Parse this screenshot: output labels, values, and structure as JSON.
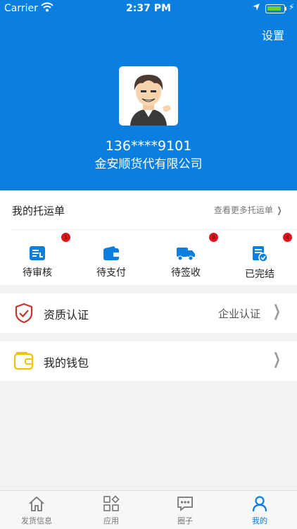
{
  "status_bar": {
    "carrier": "Carrier",
    "time": "2:37 PM"
  },
  "header": {
    "settings_label": "设置",
    "phone": "136****9101",
    "company": "金安顺货代有限公司"
  },
  "orders": {
    "title": "我的托运单",
    "more_label": "查看更多托运单",
    "statuses": [
      {
        "label": "待审核",
        "badge": "1"
      },
      {
        "label": "待支付"
      },
      {
        "label": "待签收",
        "badge": "8"
      },
      {
        "label": "已完结",
        "badge": "4"
      }
    ]
  },
  "qualification": {
    "label": "资质认证",
    "value": "企业认证"
  },
  "wallet": {
    "label": "我的钱包"
  },
  "tabbar": {
    "active": "我的",
    "tabs": [
      {
        "label": "发货信息"
      },
      {
        "label": "应用"
      },
      {
        "label": "圈子"
      },
      {
        "label": "我的"
      }
    ]
  },
  "colors": {
    "primary": "#0a7fe0",
    "badge": "#d9171e",
    "wallet_icon": "#f5c200",
    "shield_icon": "#c8352f"
  }
}
